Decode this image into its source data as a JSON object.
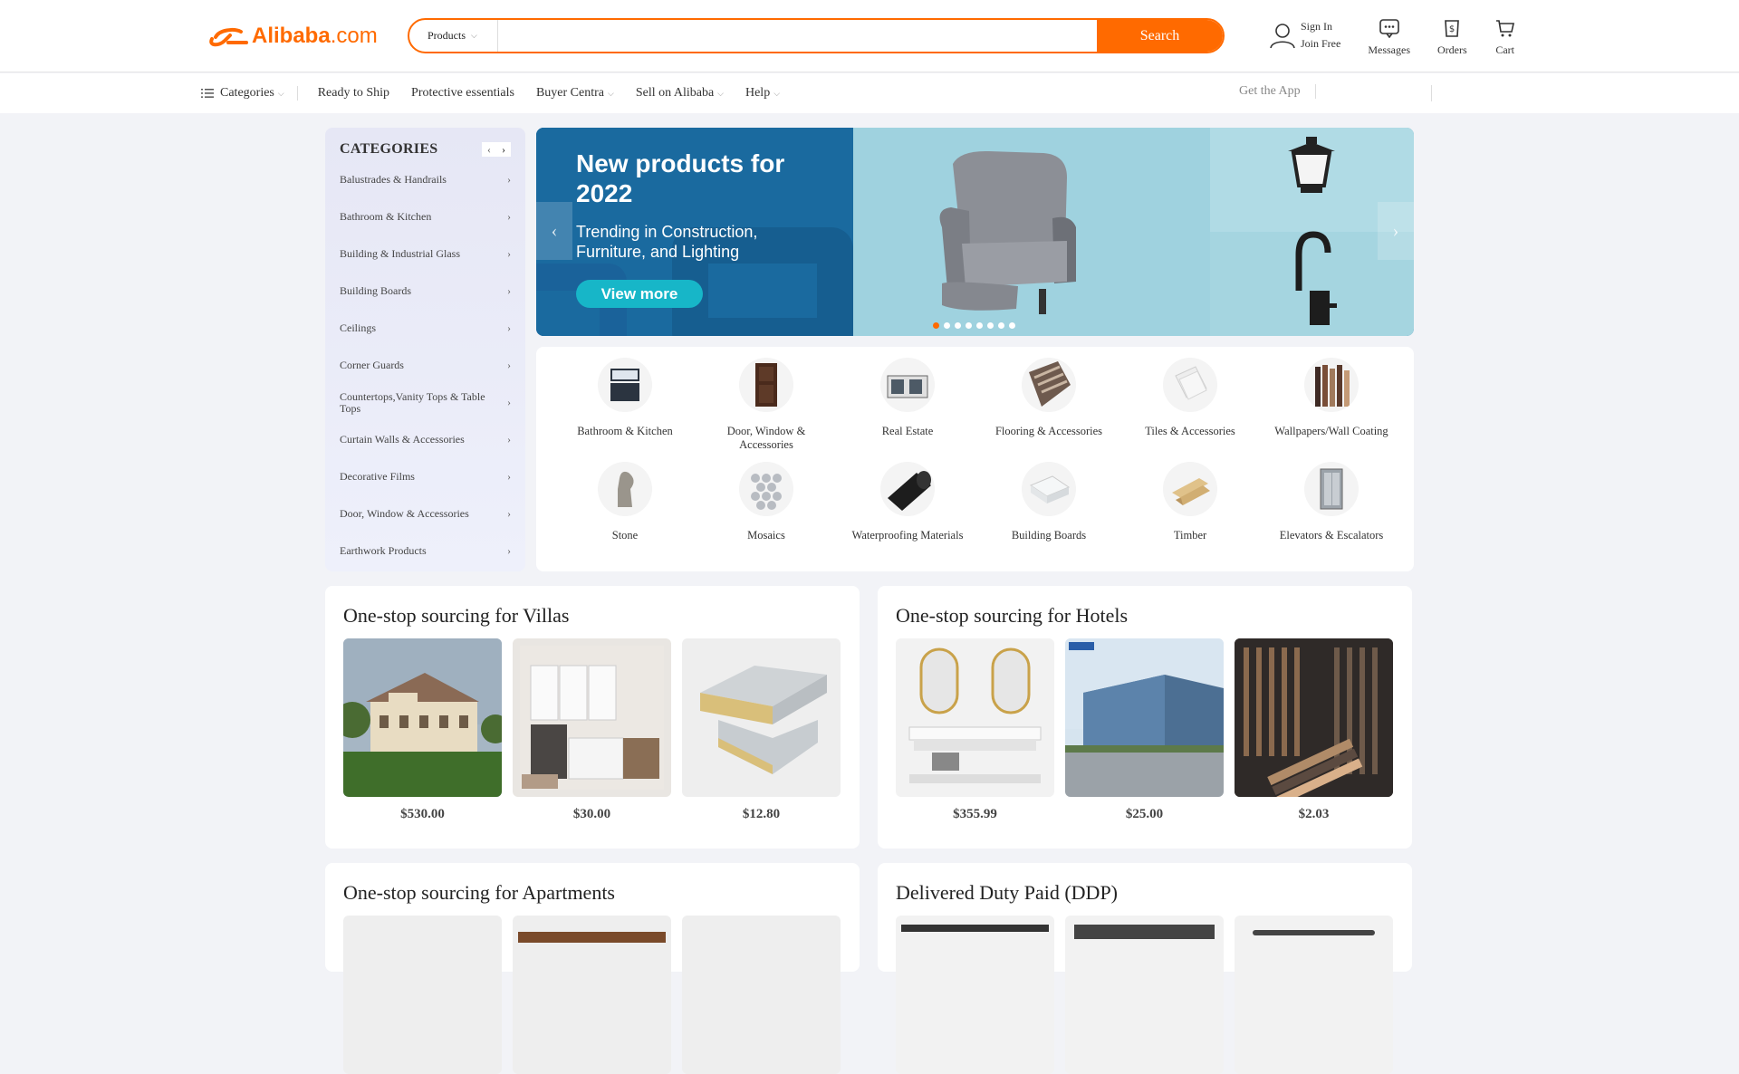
{
  "header": {
    "logo": {
      "brand": "Alibaba",
      "suffix": ".com",
      "color": "#ff6a00"
    },
    "search": {
      "type_label": "Products",
      "value": "",
      "placeholder": "",
      "button_label": "Search"
    },
    "account": {
      "sign_in": "Sign In",
      "join": "Join Free"
    },
    "actions": {
      "messages": "Messages",
      "orders": "Orders",
      "cart": "Cart"
    }
  },
  "subnav": {
    "categories": "Categories",
    "items": [
      "Ready to Ship",
      "Protective essentials",
      "Buyer Centra",
      "Sell on Alibaba",
      "Help"
    ],
    "get_app": "Get the App"
  },
  "sidebar": {
    "title": "CATEGORIES",
    "items": [
      "Balustrades & Handrails",
      "Bathroom & Kitchen",
      "Building & Industrial Glass",
      "Building Boards",
      "Ceilings",
      "Corner Guards",
      "Countertops,Vanity Tops & Table Tops",
      "Curtain Walls & Accessories",
      "Decorative Films",
      "Door, Window & Accessories",
      "Earthwork Products"
    ]
  },
  "banner": {
    "headline": "New products for 2022",
    "subtext": "Trending in Construction, Furniture, and Lighting",
    "button": "View more",
    "slide_count": 8,
    "active_slide": 1
  },
  "subcategories": [
    {
      "name": "Bathroom & Kitchen",
      "icon": "vanity-cabinet"
    },
    {
      "name": "Door, Window & Accessories",
      "icon": "wooden-door"
    },
    {
      "name": "Real Estate",
      "icon": "prefab-house"
    },
    {
      "name": "Flooring & Accessories",
      "icon": "flooring-planks"
    },
    {
      "name": "Tiles & Accessories",
      "icon": "tiles"
    },
    {
      "name": "Wallpapers/Wall Coating",
      "icon": "wall-panels"
    },
    {
      "name": "Stone",
      "icon": "stone-sculpture"
    },
    {
      "name": "Mosaics",
      "icon": "mosaic"
    },
    {
      "name": "Waterproofing Materials",
      "icon": "membrane-roll"
    },
    {
      "name": "Building Boards",
      "icon": "board-stack"
    },
    {
      "name": "Timber",
      "icon": "timber-beams"
    },
    {
      "name": "Elevators & Escalators",
      "icon": "elevator"
    }
  ],
  "sections": [
    {
      "title": "One-stop sourcing for Villas",
      "prices": [
        "$530.00",
        "$30.00",
        "$12.80"
      ]
    },
    {
      "title": "One-stop sourcing for Hotels",
      "prices": [
        "$355.99",
        "$25.00",
        "$2.03"
      ]
    },
    {
      "title": "One-stop sourcing for Apartments",
      "prices": []
    },
    {
      "title": "Delivered Duty Paid (DDP)",
      "prices": []
    }
  ]
}
